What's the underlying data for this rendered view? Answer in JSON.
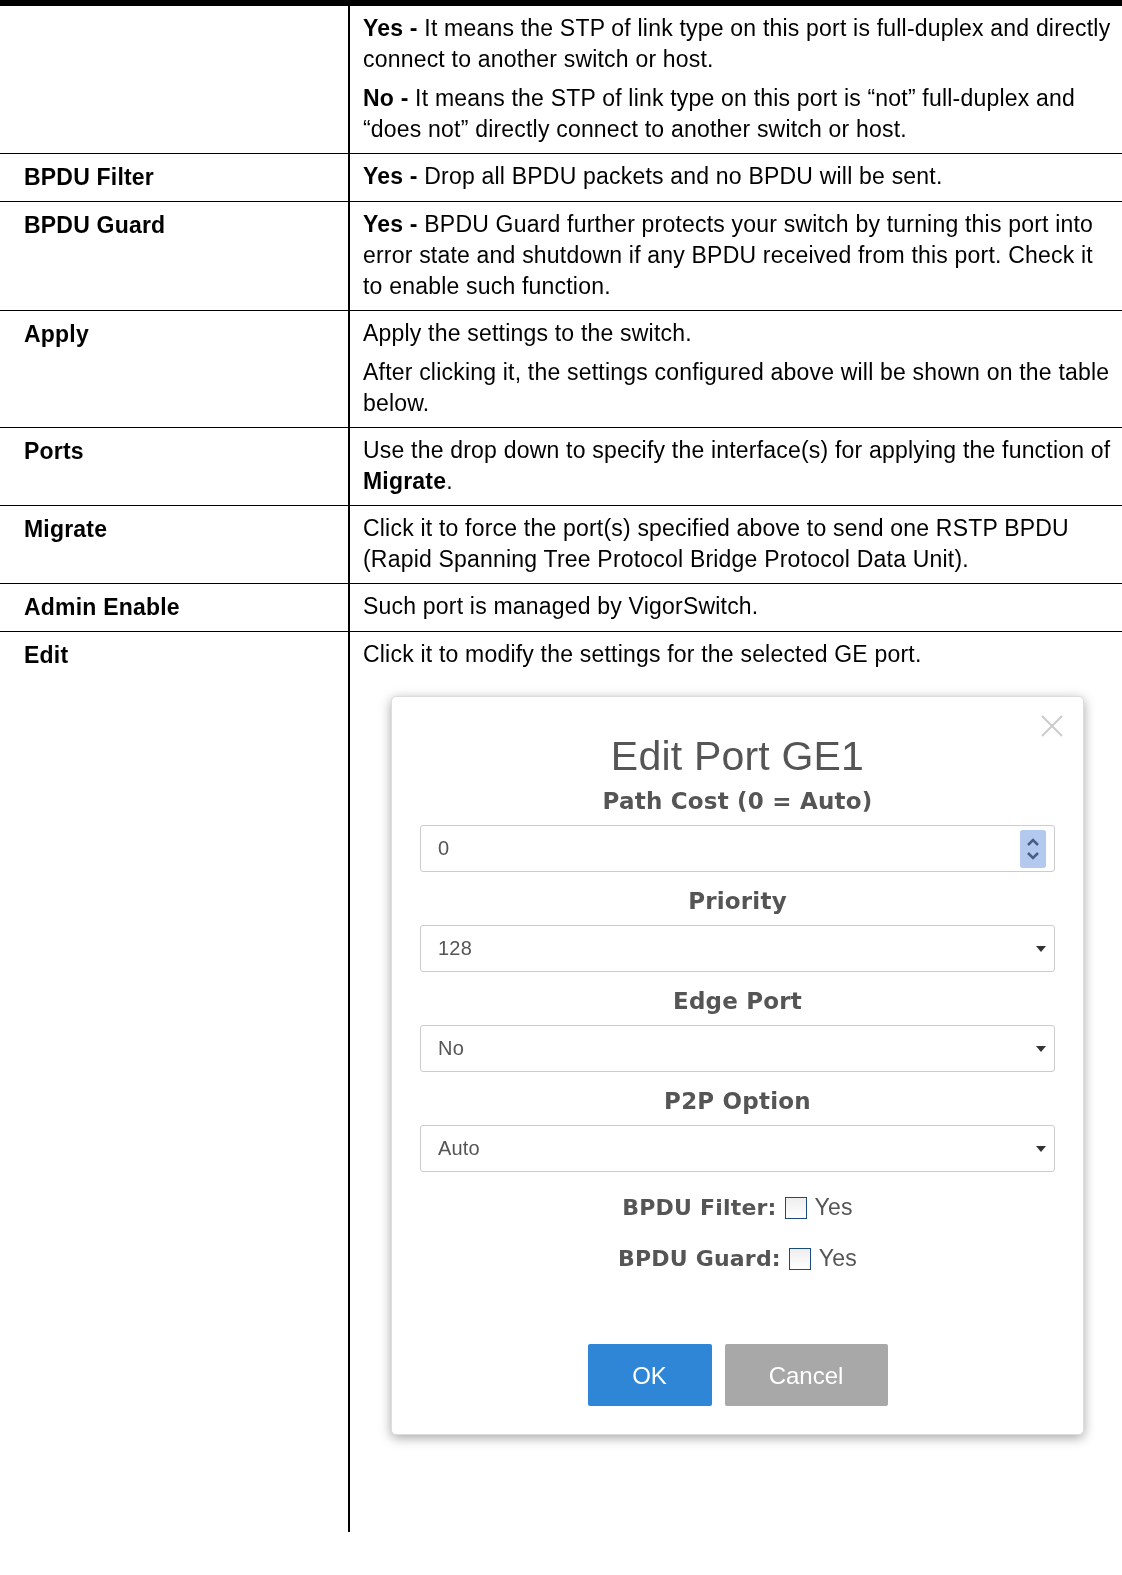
{
  "rows": [
    {
      "paragraphs": [
        "**Yes -** It means the STP of link type on this port is full-duplex and directly connect to another switch or host.",
        "**No -** It means the STP of link type on this port is “not” full-duplex and “does not” directly connect to another switch or host."
      ]
    },
    {
      "term": "BPDU Filter",
      "paragraphs": [
        "**Yes -** Drop all BPDU packets and no BPDU will be sent."
      ]
    },
    {
      "term": "BPDU Guard",
      "paragraphs": [
        "**Yes -** BPDU Guard further protects your switch by turning this port into error state and shutdown if any BPDU received from this port. Check it to enable such function."
      ]
    },
    {
      "term": "Apply",
      "paragraphs": [
        "Apply the settings to the switch.",
        "After clicking it, the settings configured above will be shown on the table below."
      ]
    },
    {
      "term": "Ports",
      "paragraphs": [
        "Use the drop down to specify the interface(s) for applying the function of **Migrate**."
      ]
    },
    {
      "term": "Migrate",
      "paragraphs": [
        "Click it to force the port(s) specified above to send one RSTP BPDU (Rapid Spanning Tree Protocol Bridge Protocol Data Unit)."
      ]
    },
    {
      "term": "Admin Enable",
      "paragraphs": [
        "Such port is managed by VigorSwitch."
      ]
    },
    {
      "term": "Edit",
      "paragraphs": [
        "Click it to modify the settings for the selected GE port."
      ],
      "dialog": {
        "title": "Edit Port GE1",
        "fields": [
          {
            "kind": "number",
            "label": "Path Cost (0 = Auto)",
            "value": "0"
          },
          {
            "kind": "select",
            "label": "Priority",
            "value": "128"
          },
          {
            "kind": "select",
            "label": "Edge Port",
            "value": "No"
          },
          {
            "kind": "select",
            "label": "P2P Option",
            "value": "Auto"
          }
        ],
        "checks": [
          {
            "label": "BPDU Filter:",
            "option": "Yes",
            "checked": false
          },
          {
            "label": "BPDU Guard:",
            "option": "Yes",
            "checked": false
          }
        ],
        "buttons": [
          {
            "label": "OK",
            "kind": "primary"
          },
          {
            "label": "Cancel",
            "kind": "secondary"
          }
        ]
      }
    }
  ]
}
